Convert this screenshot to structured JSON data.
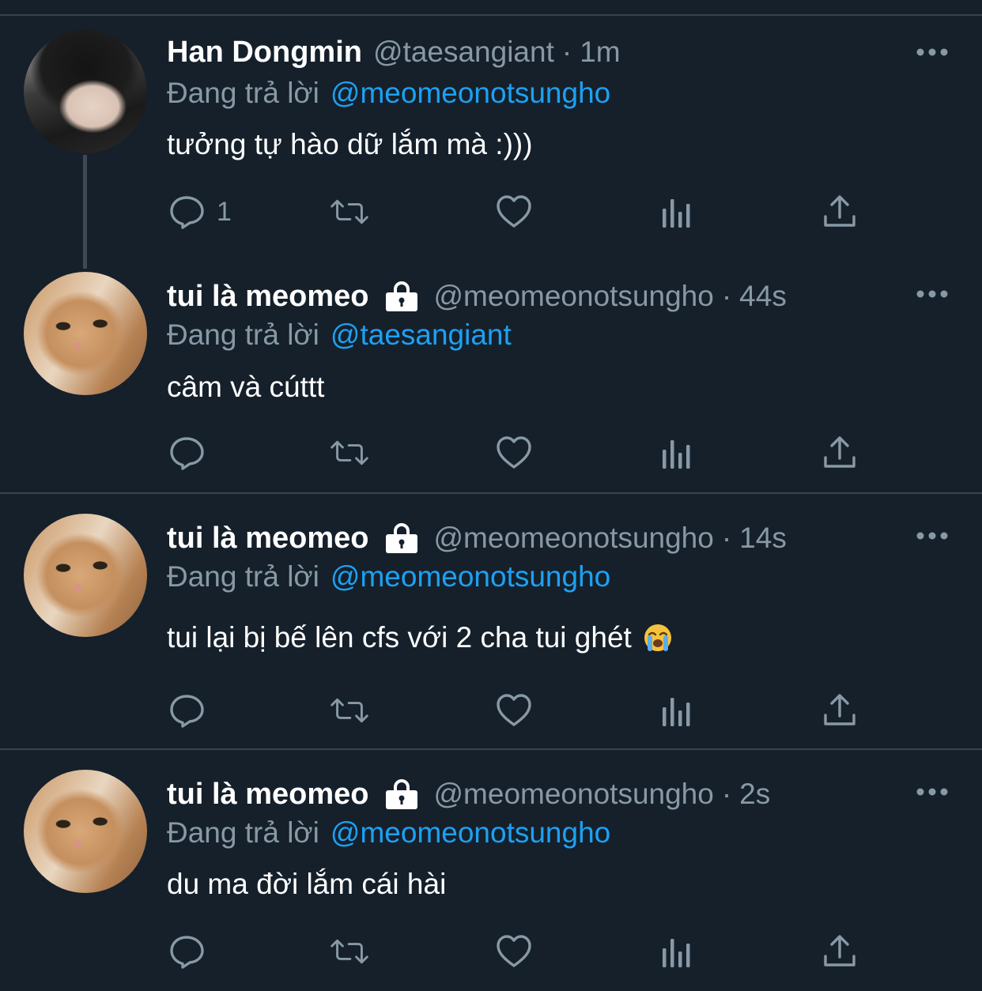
{
  "colors": {
    "background": "#15202b",
    "divider": "#38444d",
    "primary_text": "#ffffff",
    "secondary_text": "#8899a6",
    "link": "#1da1f2"
  },
  "tweets": [
    {
      "display_name": "Han Dongmin",
      "handle": "@taesangiant",
      "separator": "·",
      "time": "1m",
      "protected": false,
      "reply_prefix": "Đang trả lời",
      "reply_to": "@meomeonotsungho",
      "text": "tưởng tự hào dữ lắm mà :)))",
      "reply_count": "1",
      "avatar": "person-photo"
    },
    {
      "display_name": "tui là meomeo",
      "handle": "@meomeonotsungho",
      "separator": "·",
      "time": "44s",
      "protected": true,
      "reply_prefix": "Đang trả lời",
      "reply_to": "@taesangiant",
      "text": "câm và cúttt",
      "reply_count": "",
      "avatar": "cat-photo"
    },
    {
      "display_name": "tui là meomeo",
      "handle": "@meomeonotsungho",
      "separator": "·",
      "time": "14s",
      "protected": true,
      "reply_prefix": "Đang trả lời",
      "reply_to": "@meomeonotsungho",
      "text": "tui lại bị bế lên cfs với 2 cha tui ghét",
      "emoji": "loudly-crying-face",
      "reply_count": "",
      "avatar": "cat-photo"
    },
    {
      "display_name": "tui là meomeo",
      "handle": "@meomeonotsungho",
      "separator": "·",
      "time": "2s",
      "protected": true,
      "reply_prefix": "Đang trả lời",
      "reply_to": "@meomeonotsungho",
      "text": "du ma đời lắm cái hài",
      "reply_count": "",
      "avatar": "cat-photo"
    }
  ],
  "icons": {
    "actions": [
      "reply-icon",
      "retweet-icon",
      "like-icon",
      "analytics-icon",
      "share-icon"
    ],
    "more": "more-options-icon",
    "lock": "lock-icon"
  }
}
